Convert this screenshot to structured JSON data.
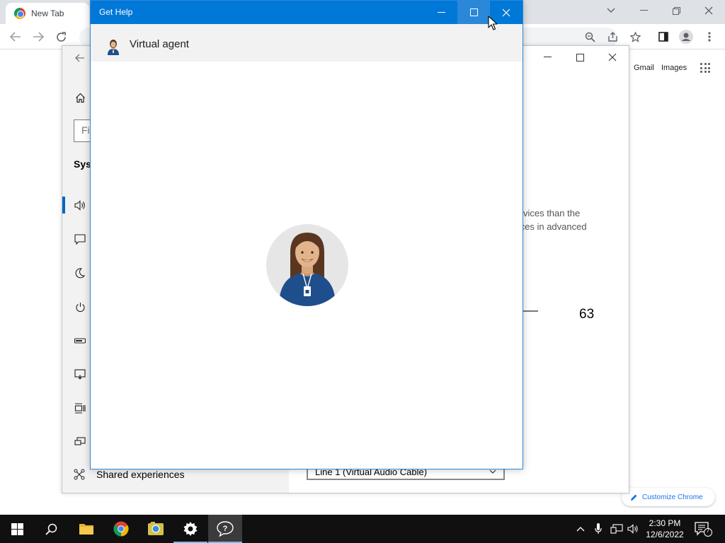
{
  "chrome": {
    "tab_title": "New Tab",
    "links": {
      "gmail": "Gmail",
      "images": "Images"
    },
    "customize_label": "Customize Chrome"
  },
  "settings": {
    "find_placeholder": "Fi",
    "section_label": "Syst",
    "description_line1": "l devices than the",
    "description_line2": "evices in advanced",
    "volume_value": "63",
    "dropdown_value": "Line 1 (Virtual Audio Cable)",
    "shared_experiences_label": "Shared experiences"
  },
  "gethelp": {
    "title": "Get Help",
    "agent_name": "Virtual agent"
  },
  "taskbar": {
    "time": "2:30 PM",
    "date": "12/6/2022",
    "notification_count": "7"
  },
  "colors": {
    "titlebar_blue": "#0078d7",
    "accent_blue": "#0067c0",
    "taskbar_bg": "#101010",
    "agent_shirt": "#1f4e8c"
  }
}
